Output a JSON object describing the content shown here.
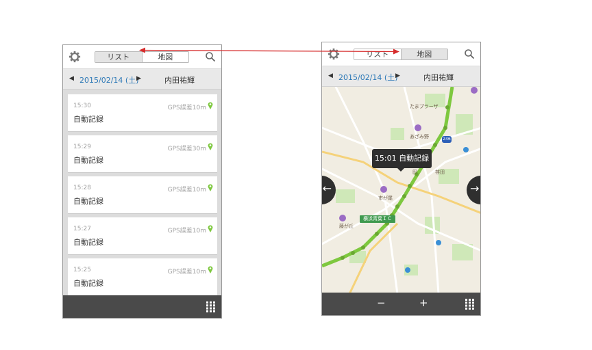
{
  "list_screen": {
    "tabs": {
      "list": "リスト",
      "map": "地図"
    },
    "date": "2015/02/14 (土)",
    "user": "内田祐輝",
    "entries": [
      {
        "time": "15:30",
        "gps": "GPS誤差10m",
        "label": "自動記録"
      },
      {
        "time": "15:29",
        "gps": "GPS誤差30m",
        "label": "自動記録"
      },
      {
        "time": "15:28",
        "gps": "GPS誤差10m",
        "label": "自動記録"
      },
      {
        "time": "15:27",
        "gps": "GPS誤差10m",
        "label": "自動記録"
      },
      {
        "time": "15:25",
        "gps": "GPS誤差10m",
        "label": "自動記録"
      }
    ]
  },
  "map_screen": {
    "tabs": {
      "list": "リスト",
      "map": "地図"
    },
    "date": "2015/02/14 (土)",
    "user": "内田祐輝",
    "tooltip": "15:01 自動記録",
    "zoom_out": "−",
    "zoom_in": "+",
    "map_labels": {
      "tamaplaza": "たまプラーザ",
      "azamino": "あざみ野",
      "ichigao": "市が尾",
      "fujigaoka": "藤が丘",
      "ic": "横浜青葉ＩＣ",
      "den": "田",
      "ogida": "荏田",
      "route": "246"
    }
  },
  "colors": {
    "accent_blue": "#2a77b6",
    "route_green": "#7ec83f",
    "arrow_red": "#d62c2c"
  },
  "icons": [
    "gear-icon",
    "search-icon",
    "pin-icon",
    "grid-icon",
    "arrow-left-icon",
    "arrow-right-icon"
  ]
}
